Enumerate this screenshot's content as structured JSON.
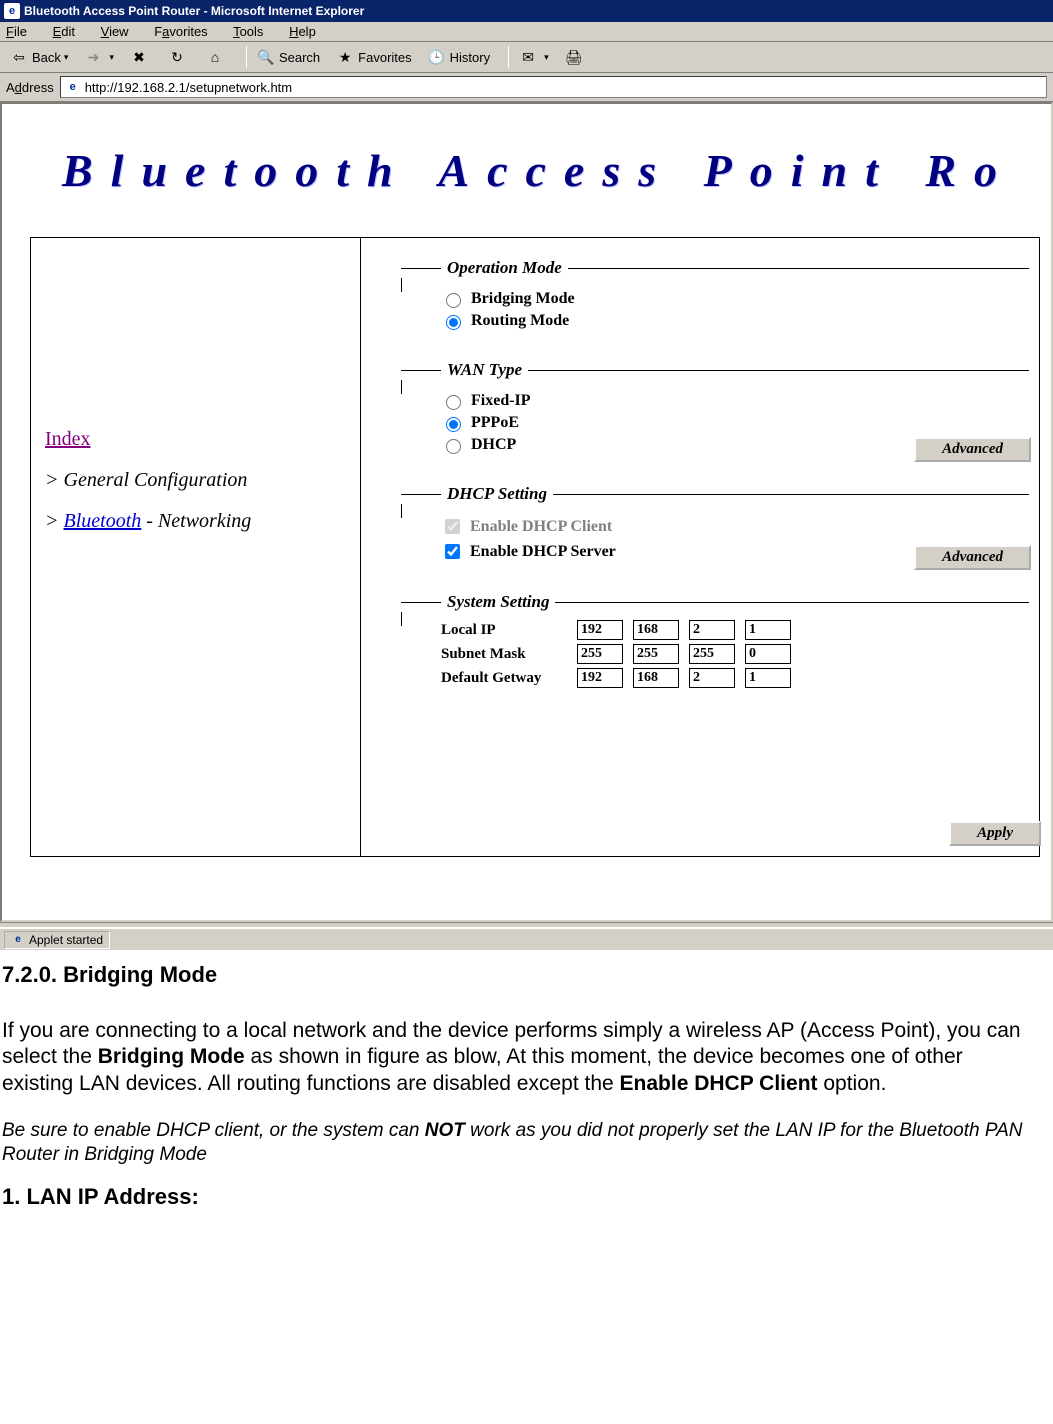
{
  "window": {
    "title": "Bluetooth Access Point Router - Microsoft Internet Explorer"
  },
  "menu": {
    "file": "File",
    "edit": "Edit",
    "view": "View",
    "favorites": "Favorites",
    "tools": "Tools",
    "help": "Help"
  },
  "toolbar": {
    "back": "Back",
    "search": "Search",
    "favorites": "Favorites",
    "history": "History"
  },
  "address": {
    "label": "Address",
    "value": "http://192.168.2.1/setupnetwork.htm"
  },
  "page": {
    "banner": "Bluetooth  Access  Point  Ro",
    "sidebar": {
      "index": "Index",
      "general": "General Configuration",
      "bluetooth": "Bluetooth",
      "networking": " - Networking"
    },
    "fieldsets": {
      "operation_mode": {
        "legend": "Operation Mode",
        "bridging": "Bridging Mode",
        "routing": "Routing Mode",
        "selected": "routing"
      },
      "wan_type": {
        "legend": "WAN Type",
        "fixed_ip": "Fixed-IP",
        "pppoe": "PPPoE",
        "dhcp": "DHCP",
        "selected": "pppoe",
        "advanced": "Advanced"
      },
      "dhcp_setting": {
        "legend": "DHCP Setting",
        "enable_client": "Enable DHCP Client",
        "enable_server": "Enable DHCP Server",
        "advanced": "Advanced"
      },
      "system_setting": {
        "legend": "System Setting",
        "local_ip_label": "Local IP",
        "local_ip": [
          "192",
          "168",
          "2",
          "1"
        ],
        "subnet_label": "Subnet Mask",
        "subnet": [
          "255",
          "255",
          "255",
          "0"
        ],
        "gateway_label": "Default Getway",
        "gateway": [
          "192",
          "168",
          "2",
          "1"
        ]
      },
      "apply": "Apply"
    }
  },
  "status": {
    "text": "Applet started"
  },
  "doc": {
    "heading": "7.2.0. Bridging Mode",
    "para_pre": "If you are connecting to a local network and the device performs simply a wireless AP (Access Point), you can select the ",
    "para_bold1": "Bridging Mode",
    "para_mid": " as shown in figure as blow, At this moment, the device becomes one of other existing LAN devices.  All routing functions are disabled except the ",
    "para_bold2": "Enable DHCP Client",
    "para_post": " option.",
    "note_pre": "Be sure to enable DHCP client, or the system can ",
    "note_bold": "NOT",
    "note_post": " work as you did not properly set the LAN IP for the Bluetooth PAN Router in Bridging Mode",
    "sub": "1. LAN IP Address:"
  }
}
